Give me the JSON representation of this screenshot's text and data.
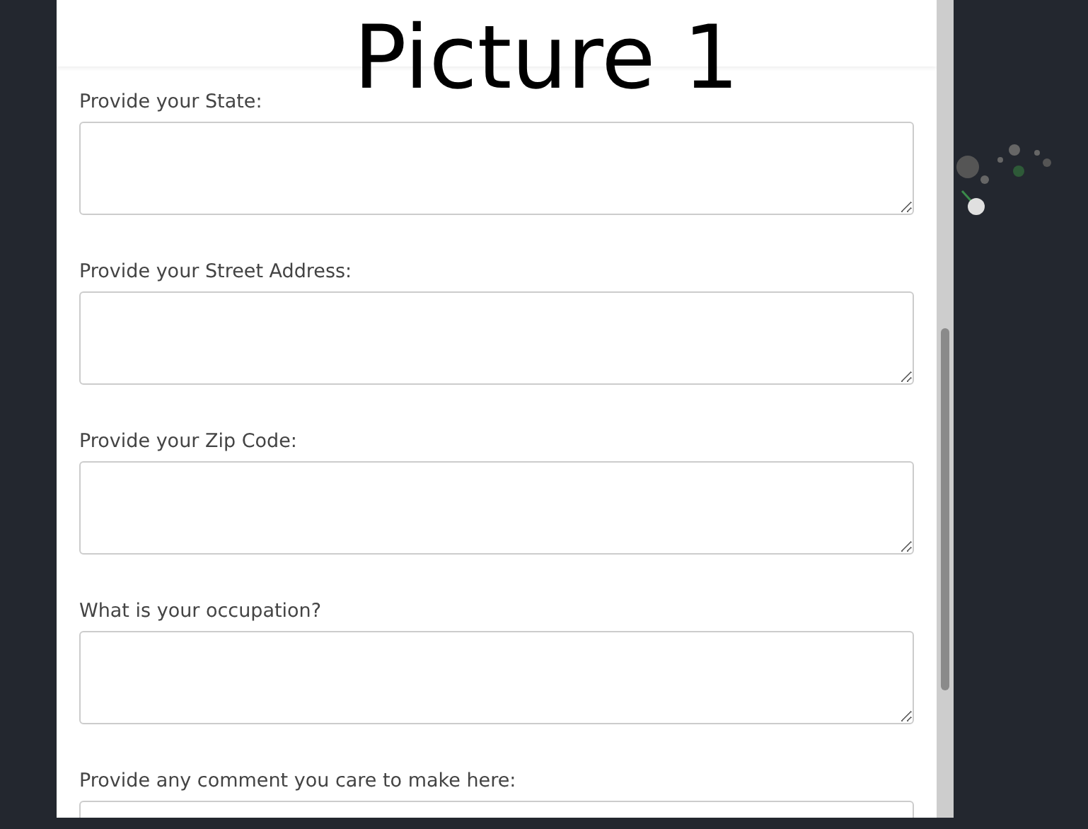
{
  "overlay_title": "Picture 1",
  "fields": [
    {
      "label": "Provide your State:"
    },
    {
      "label": "Provide your Street Address:"
    },
    {
      "label": "Provide your Zip Code:"
    },
    {
      "label": "What is your occupation?"
    },
    {
      "label": "Provide any comment you care to make here:"
    }
  ]
}
